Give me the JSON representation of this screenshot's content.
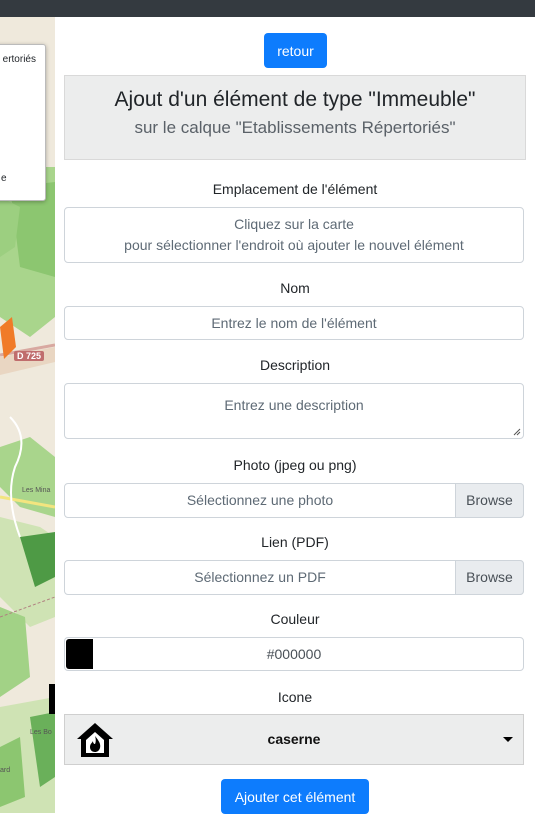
{
  "map": {
    "layer_item_1": "ertoriés",
    "layer_item_2": "e",
    "road_label": "D 725",
    "place_1": "Les Mina",
    "place_2": "Les Bo",
    "place_3": "ard"
  },
  "form": {
    "back_label": "retour",
    "title": "Ajout d'un élément de type \"Immeuble\"",
    "subtitle": "sur le calque \"Etablissements Répertoriés\"",
    "location": {
      "label": "Emplacement de l'élément",
      "line1": "Cliquez sur la carte",
      "line2": "pour sélectionner l'endroit où ajouter le nouvel élément"
    },
    "name": {
      "label": "Nom",
      "placeholder": "Entrez le nom de l'élément"
    },
    "description": {
      "label": "Description",
      "placeholder": "Entrez une description"
    },
    "photo": {
      "label": "Photo (jpeg ou png)",
      "placeholder": "Sélectionnez une photo",
      "browse": "Browse"
    },
    "pdf": {
      "label": "Lien (PDF)",
      "placeholder": "Sélectionnez un PDF",
      "browse": "Browse"
    },
    "color": {
      "label": "Couleur",
      "value": "#000000"
    },
    "icon": {
      "label": "Icone",
      "selected": "caserne",
      "icon_name": "fire-station-icon"
    },
    "submit_label": "Ajouter cet élément"
  }
}
